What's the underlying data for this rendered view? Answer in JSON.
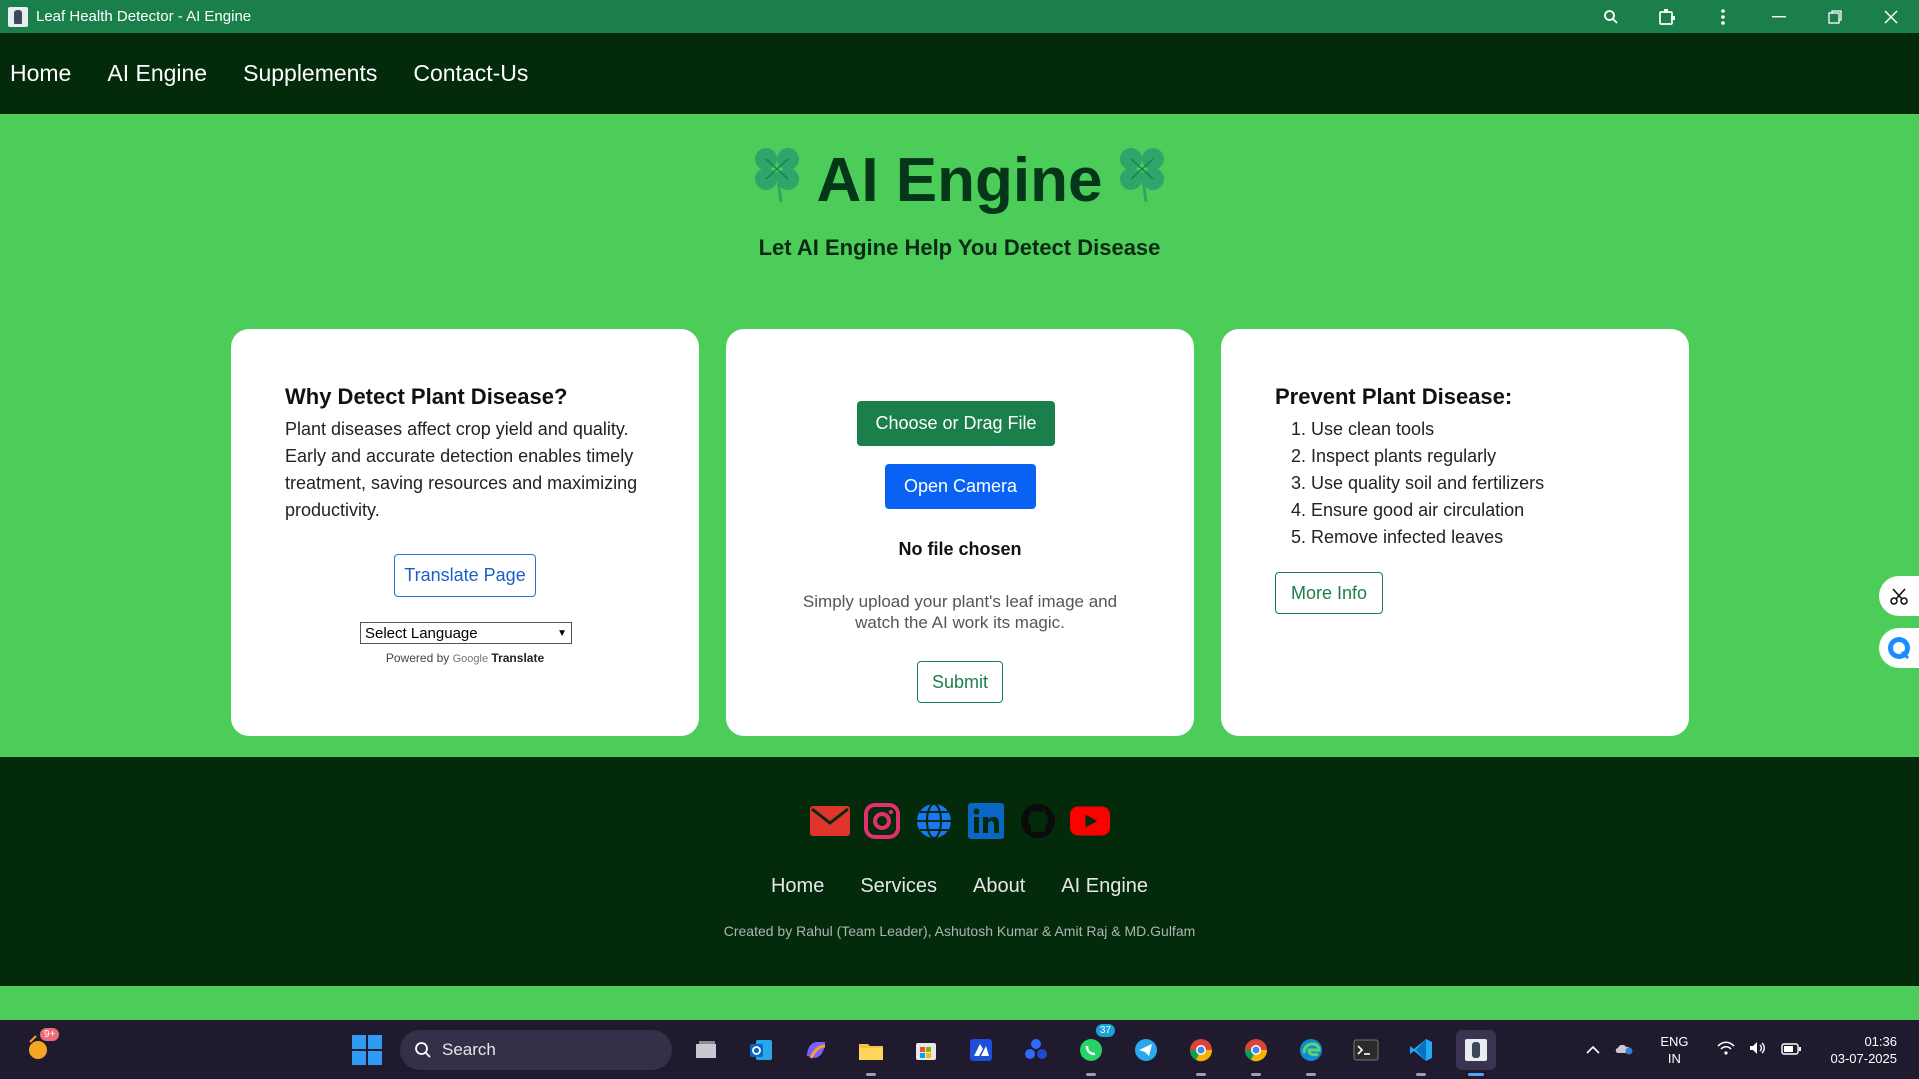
{
  "window": {
    "title": "Leaf Health Detector - AI Engine"
  },
  "navbar": {
    "items": [
      "Home",
      "AI Engine",
      "Supplements",
      "Contact-Us"
    ]
  },
  "hero": {
    "title": "AI Engine",
    "subtitle": "Let AI Engine Help You Detect Disease",
    "clover_icon": "clover-icon"
  },
  "card_left": {
    "heading": "Why Detect Plant Disease?",
    "text": "Plant diseases affect crop yield and quality. Early and accurate detection enables timely treatment, saving resources and maximizing productivity.",
    "translate_button": "Translate Page",
    "language_select": "Select Language",
    "powered_by": "Powered by",
    "google": "Google",
    "translate": "Translate"
  },
  "card_middle": {
    "choose_button": "Choose or Drag File",
    "camera_button": "Open Camera",
    "file_status": "No file chosen",
    "hint": "Simply upload your plant's leaf image and watch the AI work its magic.",
    "submit_button": "Submit"
  },
  "card_right": {
    "heading": "Prevent Plant Disease:",
    "tips": [
      "Use clean tools",
      "Inspect plants regularly",
      "Use quality soil and fertilizers",
      "Ensure good air circulation",
      "Remove infected leaves"
    ],
    "more_info_button": "More Info"
  },
  "footer": {
    "social_icons": [
      "email-icon",
      "instagram-icon",
      "globe-icon",
      "linkedin-icon",
      "github-icon",
      "youtube-icon"
    ],
    "links": [
      "Home",
      "Services",
      "About",
      "AI Engine"
    ],
    "credits": "Created by Rahul (Team Leader), Ashutosh Kumar & Amit Raj & MD.Gulfam"
  },
  "taskbar": {
    "weather_badge": "9+",
    "search_placeholder": "Search",
    "whatsapp_badge": "37",
    "language": "ENG",
    "region": "IN",
    "time": "01:36",
    "date": "03-07-2025"
  },
  "colors": {
    "page_bg": "#4ccd5a",
    "nav_bg": "#032a0b",
    "titlebar_bg": "#1b7f4c",
    "primary_green": "#1b7f4c",
    "camera_blue": "#0a62f5"
  }
}
